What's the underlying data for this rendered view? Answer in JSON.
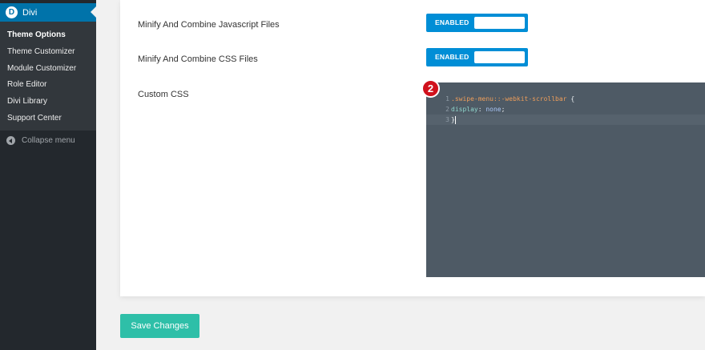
{
  "sidebar": {
    "menu_title": "Divi",
    "logo_letter": "D",
    "items": [
      {
        "label": "Theme Options"
      },
      {
        "label": "Theme Customizer"
      },
      {
        "label": "Module Customizer"
      },
      {
        "label": "Role Editor"
      },
      {
        "label": "Divi Library"
      },
      {
        "label": "Support Center"
      }
    ],
    "collapse_label": "Collapse menu"
  },
  "options": {
    "minify_js": {
      "label": "Minify And Combine Javascript Files",
      "state": "ENABLED"
    },
    "minify_css": {
      "label": "Minify And Combine CSS Files",
      "state": "ENABLED"
    },
    "custom_css": {
      "label": "Custom CSS"
    }
  },
  "editor": {
    "lines": [
      {
        "number": "1",
        "selector": ".swipe-menu::-webkit-scrollbar",
        "brace": " {"
      },
      {
        "number": "2",
        "property": "display",
        "colon": ": ",
        "value": "none",
        "semicolon": ";"
      },
      {
        "number": "3",
        "brace": "}"
      }
    ]
  },
  "step_badge": "2",
  "save_label": "Save Changes",
  "colors": {
    "admin_sidebar": "#23282d",
    "active_menu": "#0073aa",
    "toggle_blue": "#008ed6",
    "editor_bg": "#4e5a65",
    "save_button": "#2ebfa8",
    "badge_red": "#d0111c"
  }
}
